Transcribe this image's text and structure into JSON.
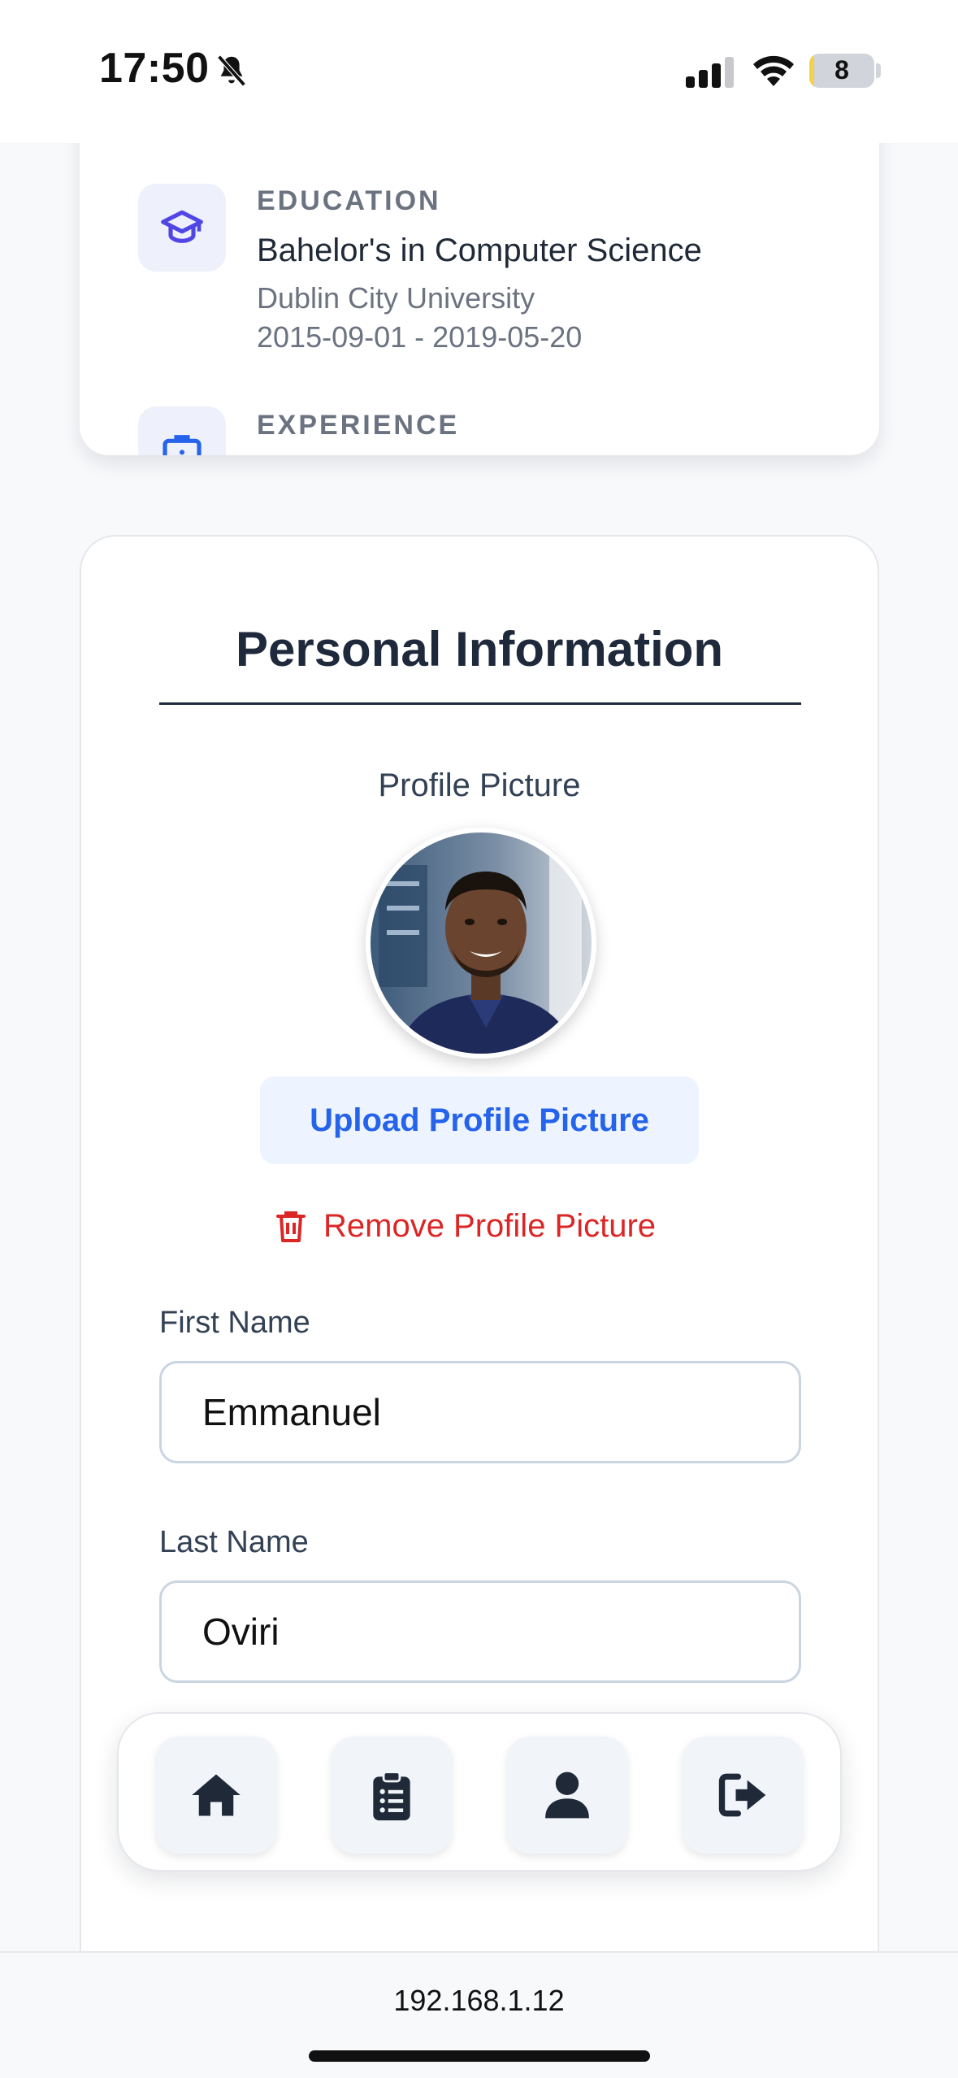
{
  "status_bar": {
    "time": "17:50",
    "battery": "8",
    "battery_level": 0.08
  },
  "education": {
    "kicker": "EDUCATION",
    "degree": "Bahelor's in Computer Science",
    "school": "Dublin City University",
    "dates": "2015-09-01 - 2019-05-20"
  },
  "experience": {
    "kicker": "EXPERIENCE"
  },
  "personal_info": {
    "title": "Personal Information",
    "profile_picture_label": "Profile Picture",
    "upload_label": "Upload Profile Picture",
    "remove_label": "Remove Profile Picture",
    "first_name_label": "First Name",
    "first_name_value": "Emmanuel",
    "last_name_label": "Last Name",
    "last_name_value": "Oviri"
  },
  "nav": {
    "icons": [
      "home-icon",
      "clipboard-list-icon",
      "user-icon",
      "logout-icon"
    ]
  },
  "browser": {
    "url": "192.168.1.12"
  },
  "colors": {
    "accent": "#2563eb",
    "danger": "#dc2626",
    "icon_purple": "#4f46e5",
    "title": "#1e293b"
  }
}
